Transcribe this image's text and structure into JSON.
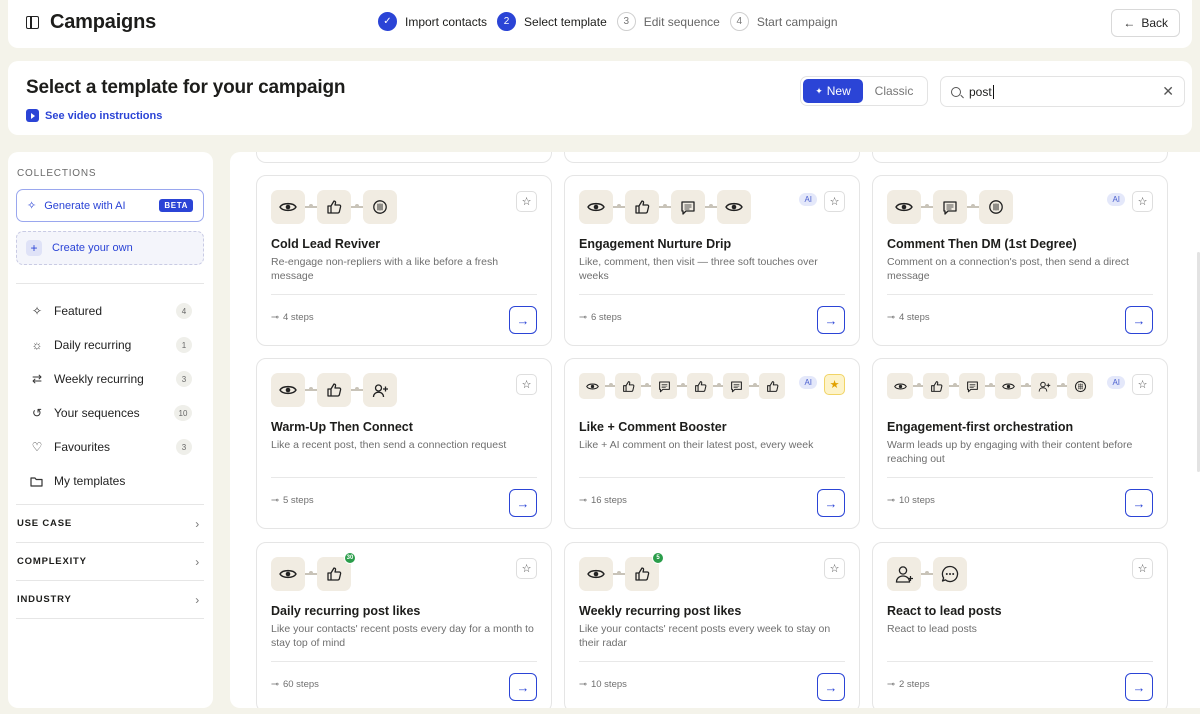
{
  "topbar": {
    "title": "Campaigns",
    "steps": [
      {
        "num": "✓",
        "label": "Import contacts",
        "state": "done"
      },
      {
        "num": "2",
        "label": "Select template",
        "state": "active"
      },
      {
        "num": "3",
        "label": "Edit sequence",
        "state": "todo"
      },
      {
        "num": "4",
        "label": "Start campaign",
        "state": "todo"
      }
    ],
    "back_label": "Back"
  },
  "header": {
    "title": "Select a template for your campaign",
    "video_link": "See video instructions",
    "toggle_new": "New",
    "toggle_classic": "Classic",
    "search_value": "post"
  },
  "sidebar": {
    "collections_label": "COLLECTIONS",
    "generate_label": "Generate with AI",
    "beta_label": "BETA",
    "create_label": "Create your own",
    "nav": [
      {
        "label": "Featured",
        "count": "4",
        "icon": "sparkle-icon"
      },
      {
        "label": "Daily recurring",
        "count": "1",
        "icon": "sun-icon"
      },
      {
        "label": "Weekly recurring",
        "count": "3",
        "icon": "repeat-icon"
      },
      {
        "label": "Your sequences",
        "count": "10",
        "icon": "history-icon"
      },
      {
        "label": "Favourites",
        "count": "3",
        "icon": "heart-icon"
      },
      {
        "label": "My templates",
        "count": "",
        "icon": "folder-icon"
      }
    ],
    "filters": [
      "USE CASE",
      "COMPLEXITY",
      "INDUSTRY"
    ]
  },
  "cards": [
    {
      "title": "Cold Lead Reviver",
      "desc": "Re-engage non-repliers with a like before a fresh message",
      "steps": "4 steps",
      "ai": "",
      "fav": false,
      "icons": [
        "eye",
        "like",
        "comment"
      ]
    },
    {
      "title": "Engagement Nurture Drip",
      "desc": "Like, comment, then visit — three soft touches over weeks",
      "steps": "6 steps",
      "ai": "AI",
      "fav": false,
      "icons": [
        "eye",
        "like",
        "message",
        "eye"
      ]
    },
    {
      "title": "Comment Then DM (1st Degree)",
      "desc": "Comment on a connection's post, then send a direct message",
      "steps": "4 steps",
      "ai": "AI",
      "fav": false,
      "icons": [
        "eye",
        "message",
        "comment"
      ]
    },
    {
      "title": "Warm-Up Then Connect",
      "desc": "Like a recent post, then send a connection request",
      "steps": "5 steps",
      "ai": "",
      "fav": false,
      "icons": [
        "eye",
        "like",
        "connect"
      ]
    },
    {
      "title": "Like + Comment Booster",
      "desc": "Like + AI comment on their latest post, every week",
      "steps": "16 steps",
      "ai": "AI",
      "fav": true,
      "icons": [
        "eye",
        "like",
        "message",
        "like",
        "message",
        "like"
      ]
    },
    {
      "title": "Engagement-first orchestration",
      "desc": "Warm leads up by engaging with their content before reaching out",
      "steps": "10 steps",
      "ai": "AI",
      "fav": false,
      "icons": [
        "eye",
        "like",
        "message",
        "eye",
        "connect",
        "comment"
      ]
    },
    {
      "title": "Daily recurring post likes",
      "desc": "Like your contacts' recent posts every day for a month to stay top of mind",
      "steps": "60 steps",
      "ai": "",
      "fav": false,
      "icons": [
        "eye",
        "like"
      ],
      "badge": "30"
    },
    {
      "title": "Weekly recurring post likes",
      "desc": "Like your contacts' recent posts every week to stay on their radar",
      "steps": "10 steps",
      "ai": "",
      "fav": false,
      "icons": [
        "eye",
        "like"
      ],
      "badge": "5"
    },
    {
      "title": "React to lead posts",
      "desc": "React to lead posts",
      "steps": "2 steps",
      "ai": "",
      "fav": false,
      "icons": [
        "profile",
        "chat"
      ]
    }
  ],
  "colors": {
    "accent": "#2b44d6",
    "background": "#f4f3ea",
    "icon_tile": "#f1ece2"
  }
}
